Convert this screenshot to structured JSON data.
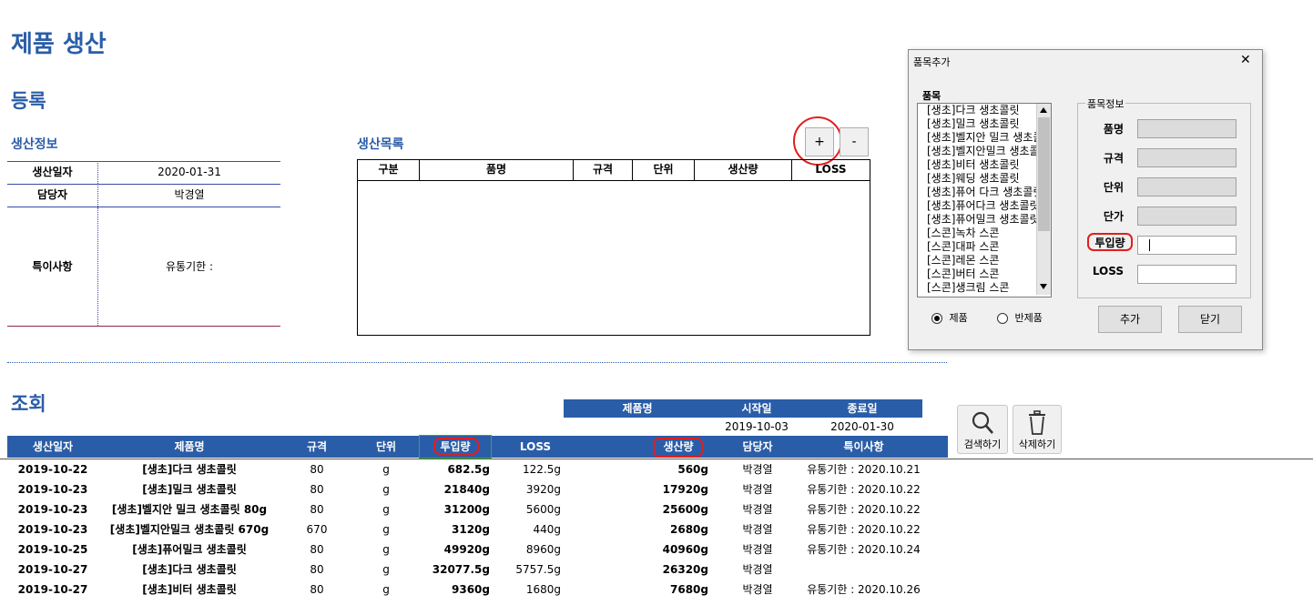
{
  "page_title": "제품 생산",
  "register": {
    "title": "등록",
    "info_title": "생산정보",
    "fields": [
      {
        "label": "생산일자",
        "value": "2020-01-31"
      },
      {
        "label": "담당자",
        "value": "박경열"
      },
      {
        "label": "특이사항",
        "value": "유통기한 :"
      }
    ]
  },
  "production_list": {
    "title": "생산목록",
    "add_label": "+",
    "remove_label": "-",
    "columns": [
      "구분",
      "품명",
      "규격",
      "단위",
      "생산량",
      "LOSS"
    ]
  },
  "query": {
    "title": "조회",
    "filter_headers": [
      "제품명",
      "시작일",
      "종료일"
    ],
    "filter_values": {
      "product": "",
      "start": "2019-10-03",
      "end": "2020-01-30"
    },
    "search_label": "검색하기",
    "delete_label": "삭제하기",
    "columns": [
      "생산일자",
      "제품명",
      "규격",
      "단위",
      "투입량",
      "LOSS",
      "생산량",
      "담당자",
      "특이사항"
    ],
    "rows": [
      [
        "2019-10-22",
        "[생초]다크 생초콜릿",
        "80",
        "g",
        "682.5g",
        "122.5g",
        "560g",
        "박경열",
        "유통기한 : 2020.10.21"
      ],
      [
        "2019-10-23",
        "[생초]밀크 생초콜릿",
        "80",
        "g",
        "21840g",
        "3920g",
        "17920g",
        "박경열",
        "유통기한 : 2020.10.22"
      ],
      [
        "2019-10-23",
        "[생초]벨지안 밀크 생초콜릿 80g",
        "80",
        "g",
        "31200g",
        "5600g",
        "25600g",
        "박경열",
        "유통기한 : 2020.10.22"
      ],
      [
        "2019-10-23",
        "[생초]벨지안밀크 생초콜릿 670g",
        "670",
        "g",
        "3120g",
        "440g",
        "2680g",
        "박경열",
        "유통기한 : 2020.10.22"
      ],
      [
        "2019-10-25",
        "[생초]퓨어밀크 생초콜릿",
        "80",
        "g",
        "49920g",
        "8960g",
        "40960g",
        "박경열",
        "유통기한 : 2020.10.24"
      ],
      [
        "2019-10-27",
        "[생초]다크 생초콜릿",
        "80",
        "g",
        "32077.5g",
        "5757.5g",
        "26320g",
        "박경열",
        ""
      ],
      [
        "2019-10-27",
        "[생초]비터 생초콜릿",
        "80",
        "g",
        "9360g",
        "1680g",
        "7680g",
        "박경열",
        "유통기한 : 2020.10.26"
      ]
    ]
  },
  "dialog": {
    "title": "품목추가",
    "close_glyph": "✕",
    "list_label": "품목",
    "items": [
      "[생초]다크 생초콜릿",
      "[생초]밀크 생초콜릿",
      "[생초]벨지안 밀크 생초콜",
      "[생초]벨지안밀크 생초콜",
      "[생초]비터 생초콜릿",
      "[생초]웨딩 생초콜릿",
      "[생초]퓨어 다크 생초콜릿",
      "[생초]퓨어다크 생초콜릿",
      "[생초]퓨어밀크 생초콜릿",
      "[스콘]녹차 스콘",
      "[스콘]대파 스콘",
      "[스콘]레몬 스콘",
      "[스콘]버터 스콘",
      "[스콘]생크림 스콘"
    ],
    "info_label": "품목정보",
    "field_labels": [
      "품명",
      "규격",
      "단위",
      "단가",
      "투입량",
      "LOSS"
    ],
    "radio_product": "제품",
    "radio_semi": "반제품",
    "add_label": "추가",
    "close_label": "닫기"
  }
}
